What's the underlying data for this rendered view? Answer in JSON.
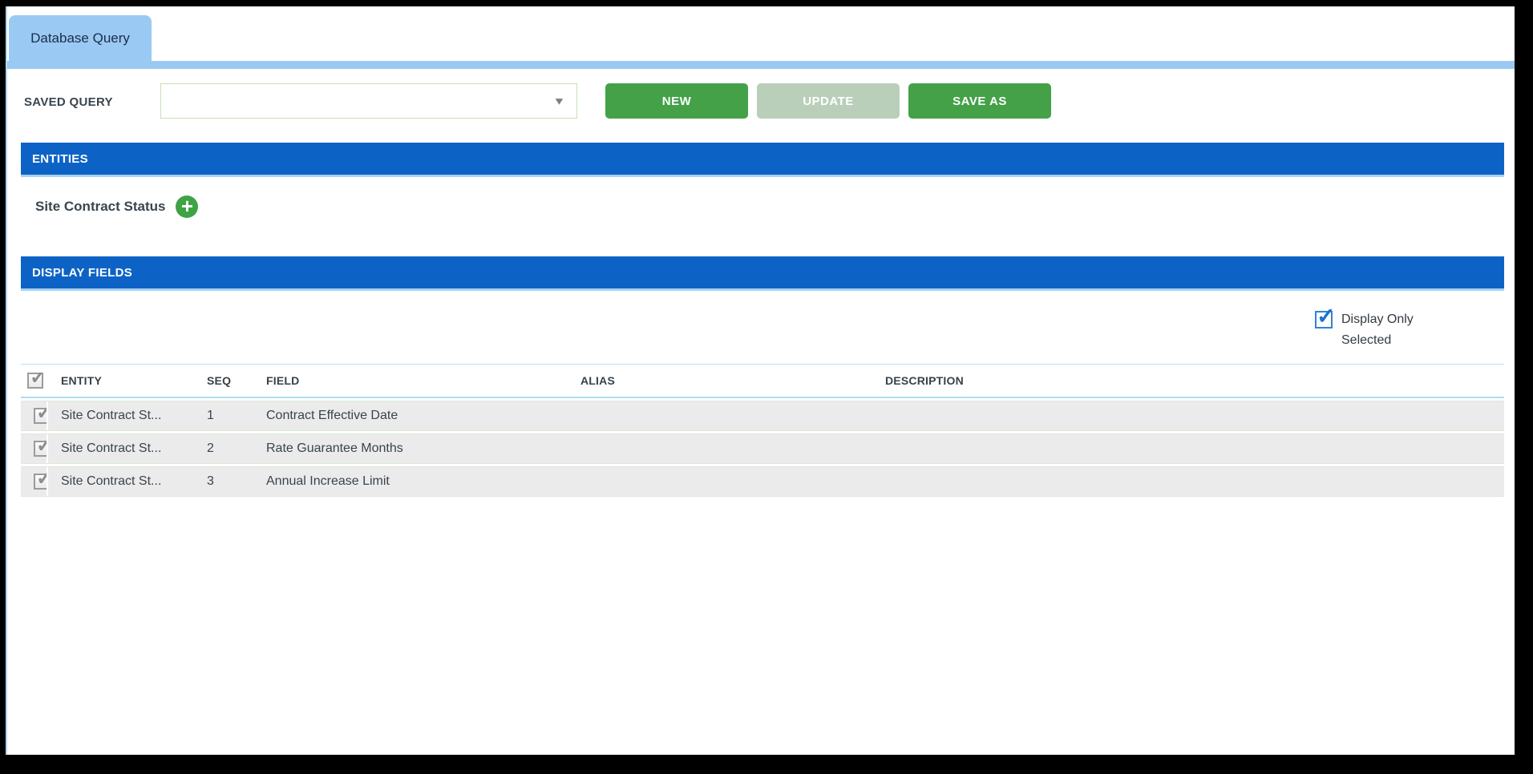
{
  "window": {
    "tab_label": "Database Query"
  },
  "saved_query": {
    "label": "SAVED QUERY",
    "selected_value": ""
  },
  "toolbar": {
    "new_label": "NEW",
    "update_label": "UPDATE",
    "save_as_label": "SAVE AS"
  },
  "entities": {
    "header": "ENTITIES",
    "entity_name": "Site Contract Status"
  },
  "display_fields": {
    "header": "DISPLAY FIELDS",
    "display_only_label": "Display Only Selected",
    "columns": {
      "entity": "ENTITY",
      "seq": "SEQ",
      "field": "FIELD",
      "alias": "ALIAS",
      "description": "DESCRIPTION"
    },
    "rows": [
      {
        "checked": true,
        "entity": "Site Contract St...",
        "seq": "1",
        "field": "Contract Effective Date",
        "alias": "",
        "description": ""
      },
      {
        "checked": true,
        "entity": "Site Contract St...",
        "seq": "2",
        "field": "Rate Guarantee Months",
        "alias": "",
        "description": ""
      },
      {
        "checked": true,
        "entity": "Site Contract St...",
        "seq": "3",
        "field": "Annual Increase Limit",
        "alias": "",
        "description": ""
      }
    ]
  },
  "icons": {
    "plus_icon": "+",
    "check_icon": "✓",
    "dropdown_arrow_icon": "▼"
  },
  "colors": {
    "section_bar_blue": "#0d63c5",
    "tab_light_blue": "#9acaf3",
    "button_green": "#44a148",
    "button_green_disabled": "#b9cfba",
    "row_gray": "#ebebeb",
    "frame_black": "#000000"
  }
}
